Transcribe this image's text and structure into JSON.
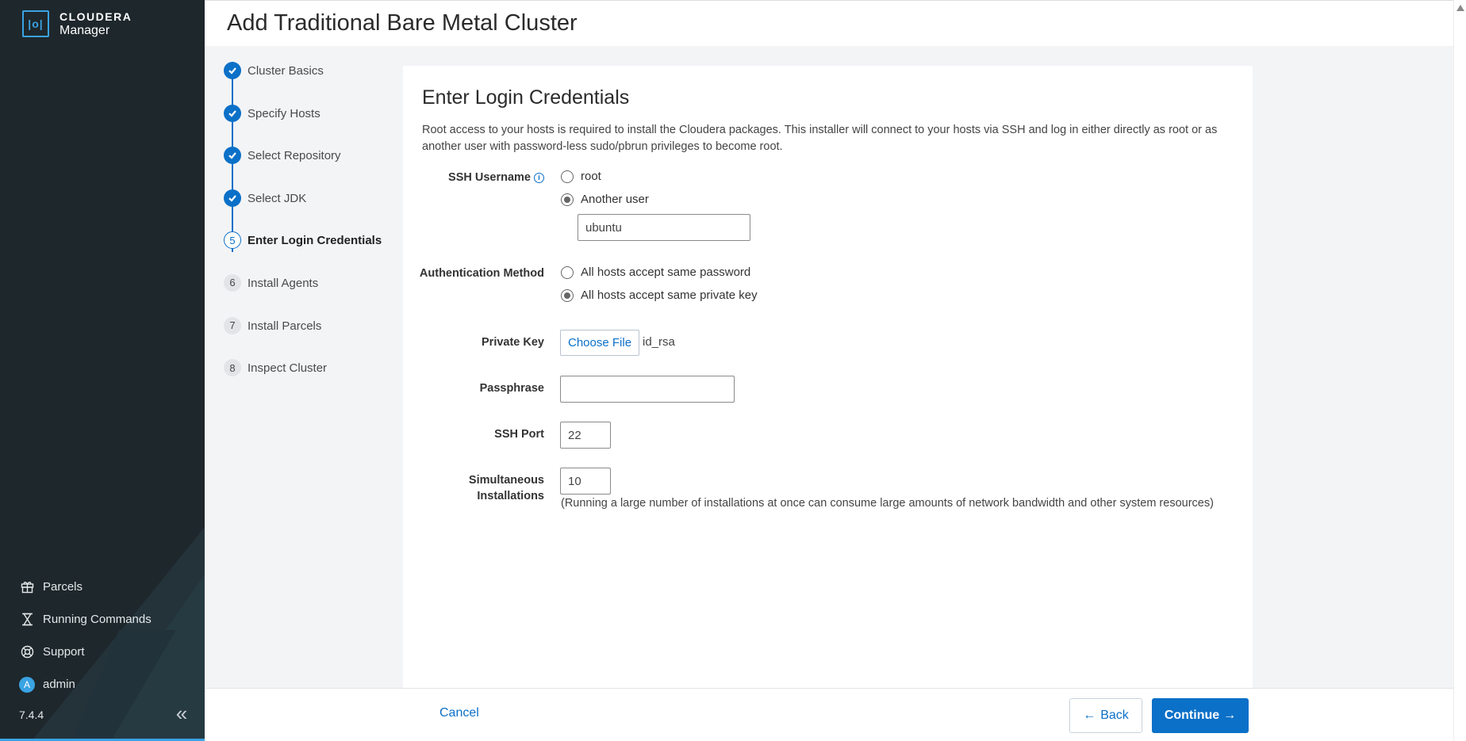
{
  "brand": {
    "logo_text": "|o|",
    "name": "CLOUDERA",
    "product": "Manager"
  },
  "header": {
    "title": "Add Traditional Bare Metal Cluster"
  },
  "steps": [
    {
      "number": "1",
      "label": "Cluster Basics",
      "state": "done"
    },
    {
      "number": "2",
      "label": "Specify Hosts",
      "state": "done"
    },
    {
      "number": "3",
      "label": "Select Repository",
      "state": "done"
    },
    {
      "number": "4",
      "label": "Select JDK",
      "state": "done"
    },
    {
      "number": "5",
      "label": "Enter Login Credentials",
      "state": "active"
    },
    {
      "number": "6",
      "label": "Install Agents",
      "state": "todo"
    },
    {
      "number": "7",
      "label": "Install Parcels",
      "state": "todo"
    },
    {
      "number": "8",
      "label": "Inspect Cluster",
      "state": "todo"
    }
  ],
  "form": {
    "title": "Enter Login Credentials",
    "description": "Root access to your hosts is required to install the Cloudera packages. This installer will connect to your hosts via SSH and log in either directly as root or as another user with password-less sudo/pbrun privileges to become root.",
    "ssh_username": {
      "label": "SSH Username",
      "options": [
        "root",
        "Another user"
      ],
      "selected": "Another user",
      "value": "ubuntu"
    },
    "auth_method": {
      "label": "Authentication Method",
      "options": [
        "All hosts accept same password",
        "All hosts accept same private key"
      ],
      "selected": "All hosts accept same private key"
    },
    "private_key": {
      "label": "Private Key",
      "button": "Choose File",
      "file": "id_rsa"
    },
    "passphrase": {
      "label": "Passphrase",
      "value": ""
    },
    "ssh_port": {
      "label": "SSH Port",
      "value": "22"
    },
    "simultaneous": {
      "label_line1": "Simultaneous",
      "label_line2": "Installations",
      "value": "10",
      "hint": "(Running a large number of installations at once can consume large amounts of network bandwidth and other system resources)"
    }
  },
  "sidebar": {
    "items": [
      {
        "label": "Parcels",
        "icon": "gift-icon"
      },
      {
        "label": "Running Commands",
        "icon": "hourglass-icon"
      },
      {
        "label": "Support",
        "icon": "lifebuoy-icon"
      },
      {
        "label": "admin",
        "icon": "user-avatar",
        "avatar_letter": "A"
      }
    ],
    "version": "7.4.4"
  },
  "footer": {
    "cancel": "Cancel",
    "back": "Back",
    "continue": "Continue"
  },
  "colors": {
    "accent": "#0b70c8",
    "sidebar_bg": "#1e272c",
    "sidebar_accent": "#3aa3e3"
  }
}
